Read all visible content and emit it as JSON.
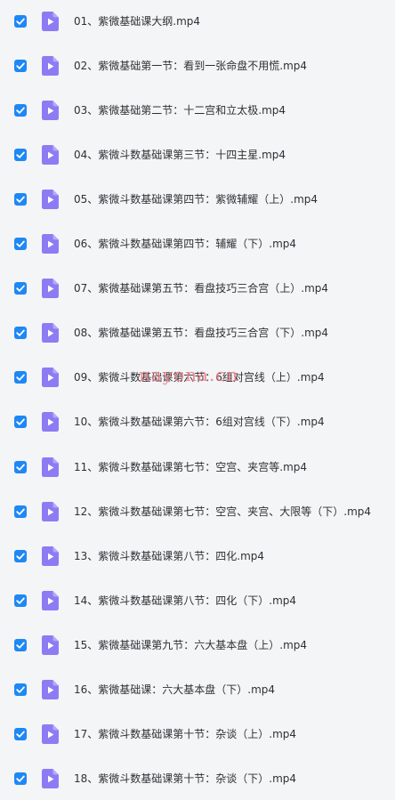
{
  "colors": {
    "checkbox": "#1e88f5",
    "video_icon": "#8c7cf4",
    "watermark": "#f07a84"
  },
  "files": [
    {
      "name": "01、紫微基础课大纲.mp4",
      "checked": true,
      "icon": "video-file-icon"
    },
    {
      "name": "02、紫微基础第一节：看到一张命盘不用慌.mp4",
      "checked": true,
      "icon": "video-file-icon"
    },
    {
      "name": "03、紫微基础第二节：十二宫和立太极.mp4",
      "checked": true,
      "icon": "video-file-icon"
    },
    {
      "name": "04、紫微斗数基础课第三节：十四主星.mp4",
      "checked": true,
      "icon": "video-file-icon"
    },
    {
      "name": "05、紫微斗数基础课第四节：紫微辅耀（上）.mp4",
      "checked": true,
      "icon": "video-file-icon"
    },
    {
      "name": "06、紫微斗数基础课第四节：辅耀（下）.mp4",
      "checked": true,
      "icon": "video-file-icon"
    },
    {
      "name": "07、紫微基础课第五节：看盘技巧三合宫（上）.mp4",
      "checked": true,
      "icon": "video-file-icon"
    },
    {
      "name": "08、紫微基础课第五节：看盘技巧三合宫（下）.mp4",
      "checked": true,
      "icon": "video-file-icon"
    },
    {
      "name": "09、紫微斗数基础课第六节：6组对宫线（上）.mp4",
      "checked": true,
      "icon": "video-file-icon"
    },
    {
      "name": "10、紫微斗数基础课第六节：6组对宫线（下）.mp4",
      "checked": true,
      "icon": "video-file-icon"
    },
    {
      "name": "11、紫微斗数基础课第七节：空宫、夹宫等.mp4",
      "checked": true,
      "icon": "video-file-icon"
    },
    {
      "name": "12、紫微斗数基础课第七节：空宫、夹宫、大限等（下）.mp4",
      "checked": true,
      "icon": "video-file-icon"
    },
    {
      "name": "13、紫微斗数基础课第八节：四化.mp4",
      "checked": true,
      "icon": "video-file-icon"
    },
    {
      "name": "14、紫微斗数基础课第八节：四化（下）.mp4",
      "checked": true,
      "icon": "video-file-icon"
    },
    {
      "name": "15、紫微基础课第九节：六大基本盘（上）.mp4",
      "checked": true,
      "icon": "video-file-icon"
    },
    {
      "name": "16、紫微基础课：六大基本盘（下）.mp4",
      "checked": true,
      "icon": "video-file-icon"
    },
    {
      "name": "17、紫微斗数基础课第十节：杂谈（上）.mp4",
      "checked": true,
      "icon": "video-file-icon"
    },
    {
      "name": "18、紫微斗数基础课第十节：杂谈（下）.mp4",
      "checked": true,
      "icon": "video-file-icon"
    }
  ],
  "watermark": "nayona.cn"
}
